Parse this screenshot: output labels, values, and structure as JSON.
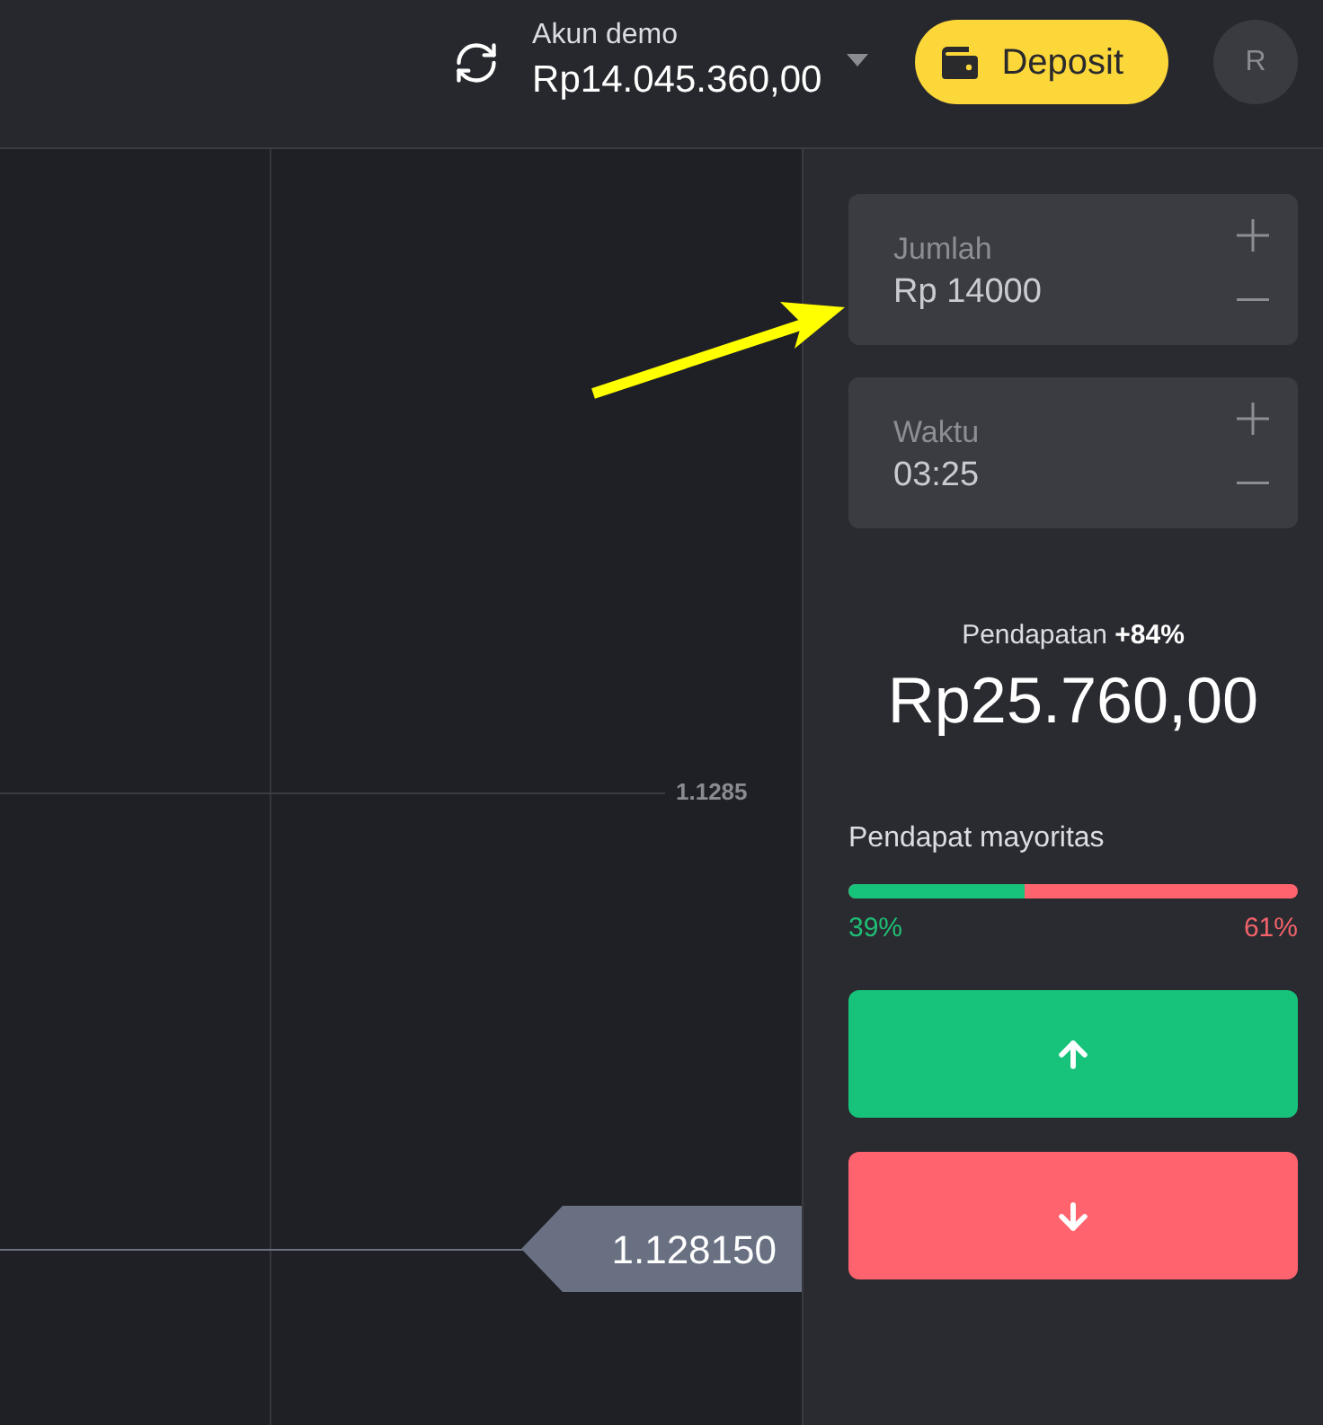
{
  "header": {
    "account_label": "Akun demo",
    "balance": "Rp14.045.360,00",
    "deposit_button": "Deposit",
    "avatar_initial": "R"
  },
  "chart": {
    "grid_label": "1.1285",
    "current_price": "1.128150"
  },
  "trade_panel": {
    "fields": [
      {
        "label": "Jumlah",
        "value": "Rp 14000"
      },
      {
        "label": "Waktu",
        "value": "03:25"
      }
    ],
    "payout": {
      "label": "Pendapatan **+84%**",
      "amount": "Rp25.760,00"
    },
    "majority": {
      "label": "Pendapat mayoritas",
      "level": 0.39,
      "up_reading": "39%",
      "down_reading": "61%"
    },
    "buttons": [
      {
        "kind": "up"
      },
      {
        "kind": "down"
      }
    ]
  }
}
